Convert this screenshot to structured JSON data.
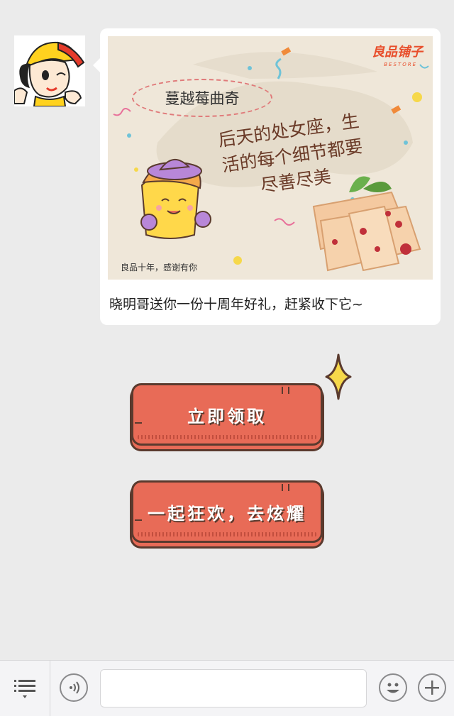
{
  "message": {
    "banner": {
      "product_name": "蔓越莓曲奇",
      "brand_name": "良品铺子",
      "brand_en": "BESTORE",
      "slogan_line1": "后天的处女座，生",
      "slogan_line2": "活的每个细节都要",
      "slogan_line3": "尽善尽美",
      "caption": "良品十年，感谢有你"
    },
    "text": "晓明哥送你一份十周年好礼，赶紧收下它~"
  },
  "actions": {
    "claim_label": "立即领取",
    "share_label": "一起狂欢，去炫耀"
  },
  "input_bar": {
    "menu_icon": "list-menu-icon",
    "voice_icon": "voice-icon",
    "emoji_icon": "emoji-icon",
    "plus_icon": "plus-icon",
    "input_value": ""
  },
  "colors": {
    "background": "#ebebeb",
    "button_fill": "#e86b57",
    "button_outline": "#5a3a2e",
    "brand": "#e84e2b"
  }
}
